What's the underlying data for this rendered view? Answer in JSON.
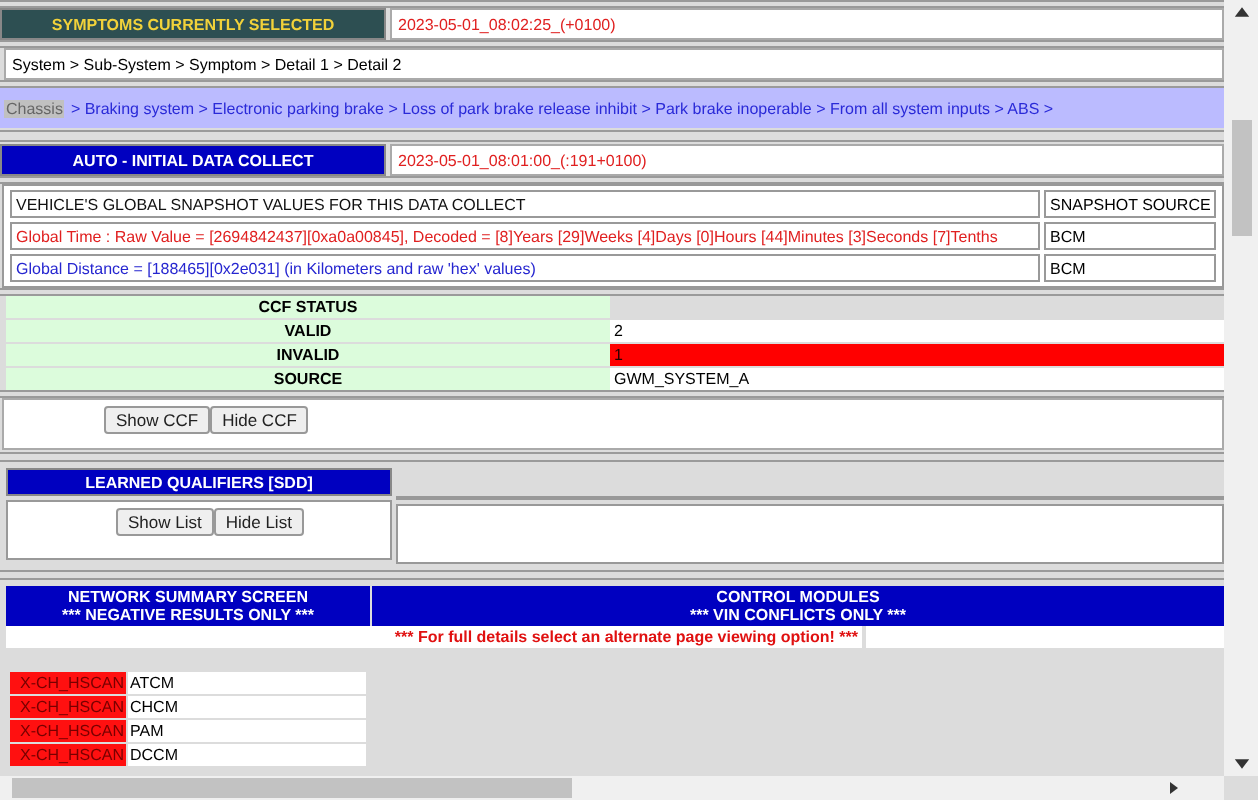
{
  "symptoms": {
    "label": "SYMPTOMS CURRENTLY SELECTED",
    "timestamp": "2023-05-01_08:02:25_(+0100)"
  },
  "breadcrumb": "System > Sub-System > Symptom > Detail 1 > Detail 2",
  "symptom_path": {
    "highlighted": "Chassis",
    "rest": "> Braking system > Electronic parking brake > Loss of park brake release inhibit > Park brake inoperable > From all system inputs > ABS >"
  },
  "data_collect": {
    "label": "AUTO - INITIAL DATA COLLECT",
    "timestamp": "2023-05-01_08:01:00_(:191+0100)"
  },
  "snapshot": {
    "rows": [
      {
        "kind": "heading",
        "text": "VEHICLE'S GLOBAL SNAPSHOT VALUES FOR THIS DATA COLLECT",
        "source": "SNAPSHOT SOURCE"
      },
      {
        "kind": "time",
        "text": "Global Time : Raw Value = [2694842437][0xa0a00845], Decoded = [8]Years [29]Weeks [4]Days [0]Hours [44]Minutes [3]Seconds [7]Tenths",
        "source": "BCM"
      },
      {
        "kind": "distance",
        "text": "Global Distance = [188465][0x2e031] (in Kilometers and raw 'hex' values)",
        "source": "BCM"
      }
    ]
  },
  "ccf_status": {
    "title": "CCF STATUS",
    "rows": [
      {
        "label": "VALID",
        "value": "2",
        "alert": false
      },
      {
        "label": "INVALID",
        "value": "1",
        "alert": true
      },
      {
        "label": "SOURCE",
        "value": "GWM_SYSTEM_A",
        "alert": false
      }
    ]
  },
  "ccf_buttons": [
    "Show CCF",
    "Hide CCF"
  ],
  "learned_qualifiers": {
    "title": "LEARNED QUALIFIERS [SDD]",
    "buttons": [
      "Show List",
      "Hide List"
    ]
  },
  "network_summary": {
    "title": "NETWORK SUMMARY SCREEN",
    "subtitle": "*** NEGATIVE RESULTS ONLY ***"
  },
  "control_modules": {
    "title": "CONTROL MODULES",
    "subtitle": "*** VIN CONFLICTS ONLY ***"
  },
  "notice": "*** For full details select an alternate page viewing option! ***",
  "network_rows": [
    {
      "bus": "X-CH_HSCAN",
      "module": "ATCM"
    },
    {
      "bus": "X-CH_HSCAN",
      "module": "CHCM"
    },
    {
      "bus": "X-CH_HSCAN",
      "module": "PAM"
    },
    {
      "bus": "X-CH_HSCAN",
      "module": "DCCM"
    }
  ]
}
